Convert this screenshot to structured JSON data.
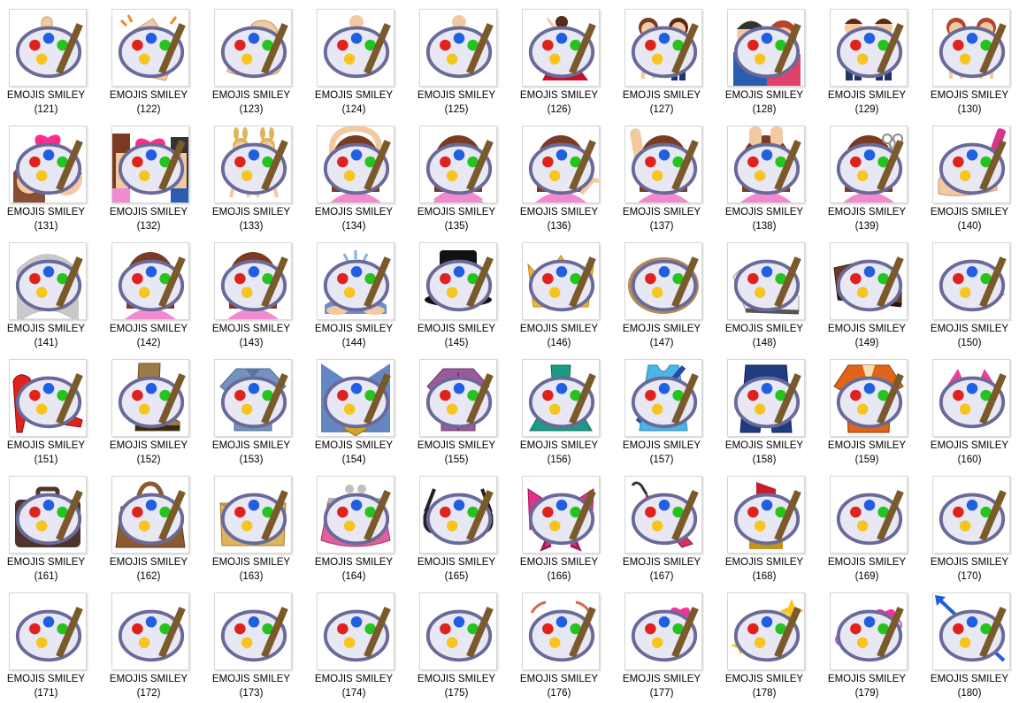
{
  "folder": {
    "label_prefix": "EMOJIS SMILEY",
    "items": [
      {
        "name": "EMOJIS SMILEY",
        "number": "(121)",
        "icon": "pointing-up-icon",
        "color": "#f3c9a0"
      },
      {
        "name": "EMOJIS SMILEY",
        "number": "(122)",
        "icon": "clapping-hands-icon",
        "color": "#f3c9a0"
      },
      {
        "name": "EMOJIS SMILEY",
        "number": "(123)",
        "icon": "flexed-biceps-icon",
        "color": "#f3c9a0"
      },
      {
        "name": "EMOJIS SMILEY",
        "number": "(124)",
        "icon": "person-walking-icon",
        "color": "#e02d2d"
      },
      {
        "name": "EMOJIS SMILEY",
        "number": "(125)",
        "icon": "person-running-icon",
        "color": "#e02d2d"
      },
      {
        "name": "EMOJIS SMILEY",
        "number": "(126)",
        "icon": "woman-dancing-icon",
        "color": "#c8102e"
      },
      {
        "name": "EMOJIS SMILEY",
        "number": "(127)",
        "icon": "couple-holding-hands-icon",
        "color": "#e84a7a"
      },
      {
        "name": "EMOJIS SMILEY",
        "number": "(128)",
        "icon": "family-icon",
        "color": "#2a5db0"
      },
      {
        "name": "EMOJIS SMILEY",
        "number": "(129)",
        "icon": "two-men-holding-hands-icon",
        "color": "#f39a1e"
      },
      {
        "name": "EMOJIS SMILEY",
        "number": "(130)",
        "icon": "two-women-holding-hands-icon",
        "color": "#ea6aa0"
      },
      {
        "name": "EMOJIS SMILEY",
        "number": "(131)",
        "icon": "kiss-icon",
        "color": "#ff2d8a"
      },
      {
        "name": "EMOJIS SMILEY",
        "number": "(132)",
        "icon": "couple-with-heart-icon",
        "color": "#ff2d8a"
      },
      {
        "name": "EMOJIS SMILEY",
        "number": "(133)",
        "icon": "women-with-bunny-ears-icon",
        "color": "#222222"
      },
      {
        "name": "EMOJIS SMILEY",
        "number": "(134)",
        "icon": "person-gesturing-ok-icon",
        "color": "#f08bd0"
      },
      {
        "name": "EMOJIS SMILEY",
        "number": "(135)",
        "icon": "person-gesturing-no-icon",
        "color": "#f08bd0"
      },
      {
        "name": "EMOJIS SMILEY",
        "number": "(136)",
        "icon": "person-tipping-hand-icon",
        "color": "#f08bd0"
      },
      {
        "name": "EMOJIS SMILEY",
        "number": "(137)",
        "icon": "person-raising-hand-icon",
        "color": "#f08bd0"
      },
      {
        "name": "EMOJIS SMILEY",
        "number": "(138)",
        "icon": "face-massage-icon",
        "color": "#f08bd0"
      },
      {
        "name": "EMOJIS SMILEY",
        "number": "(139)",
        "icon": "haircut-icon",
        "color": "#f08bd0"
      },
      {
        "name": "EMOJIS SMILEY",
        "number": "(140)",
        "icon": "nail-polish-icon",
        "color": "#d6348f"
      },
      {
        "name": "EMOJIS SMILEY",
        "number": "(141)",
        "icon": "bride-with-veil-icon",
        "color": "#c9c9c9"
      },
      {
        "name": "EMOJIS SMILEY",
        "number": "(142)",
        "icon": "person-pouting-icon",
        "color": "#f08bd0"
      },
      {
        "name": "EMOJIS SMILEY",
        "number": "(143)",
        "icon": "person-frowning-icon",
        "color": "#f08bd0"
      },
      {
        "name": "EMOJIS SMILEY",
        "number": "(144)",
        "icon": "person-bowing-icon",
        "color": "#7db3e8"
      },
      {
        "name": "EMOJIS SMILEY",
        "number": "(145)",
        "icon": "top-hat-icon",
        "color": "#111111"
      },
      {
        "name": "EMOJIS SMILEY",
        "number": "(146)",
        "icon": "crown-icon",
        "color": "#f1b82d"
      },
      {
        "name": "EMOJIS SMILEY",
        "number": "(147)",
        "icon": "womans-hat-icon",
        "color": "#b58a55"
      },
      {
        "name": "EMOJIS SMILEY",
        "number": "(148)",
        "icon": "running-shoe-icon",
        "color": "#eeeeee"
      },
      {
        "name": "EMOJIS SMILEY",
        "number": "(149)",
        "icon": "mans-shoe-icon",
        "color": "#6b3a1f"
      },
      {
        "name": "EMOJIS SMILEY",
        "number": "(150)",
        "icon": "womans-sandal-icon",
        "color": "#d9c39a"
      },
      {
        "name": "EMOJIS SMILEY",
        "number": "(151)",
        "icon": "high-heeled-shoe-icon",
        "color": "#e0221d"
      },
      {
        "name": "EMOJIS SMILEY",
        "number": "(152)",
        "icon": "womans-boot-icon",
        "color": "#9b7a45"
      },
      {
        "name": "EMOJIS SMILEY",
        "number": "(153)",
        "icon": "t-shirt-icon",
        "color": "#7393bd"
      },
      {
        "name": "EMOJIS SMILEY",
        "number": "(154)",
        "icon": "necktie-icon",
        "color": "#6487c4"
      },
      {
        "name": "EMOJIS SMILEY",
        "number": "(155)",
        "icon": "blouse-icon",
        "color": "#9c5a9a"
      },
      {
        "name": "EMOJIS SMILEY",
        "number": "(156)",
        "icon": "dress-icon",
        "color": "#199b84"
      },
      {
        "name": "EMOJIS SMILEY",
        "number": "(157)",
        "icon": "tank-top-icon",
        "color": "#4bb6e6"
      },
      {
        "name": "EMOJIS SMILEY",
        "number": "(158)",
        "icon": "jeans-icon",
        "color": "#1e3d80"
      },
      {
        "name": "EMOJIS SMILEY",
        "number": "(159)",
        "icon": "kimono-icon",
        "color": "#e0651a"
      },
      {
        "name": "EMOJIS SMILEY",
        "number": "(160)",
        "icon": "bikini-icon",
        "color": "#ee3d9a"
      },
      {
        "name": "EMOJIS SMILEY",
        "number": "(161)",
        "icon": "briefcase-icon",
        "color": "#4f342b"
      },
      {
        "name": "EMOJIS SMILEY",
        "number": "(162)",
        "icon": "handbag-icon",
        "color": "#8b5a30"
      },
      {
        "name": "EMOJIS SMILEY",
        "number": "(163)",
        "icon": "clutch-bag-icon",
        "color": "#e0b35d"
      },
      {
        "name": "EMOJIS SMILEY",
        "number": "(164)",
        "icon": "purse-icon",
        "color": "#e25f9c"
      },
      {
        "name": "EMOJIS SMILEY",
        "number": "(165)",
        "icon": "glasses-icon",
        "color": "#222222"
      },
      {
        "name": "EMOJIS SMILEY",
        "number": "(166)",
        "icon": "ribbon-icon",
        "color": "#e0308a"
      },
      {
        "name": "EMOJIS SMILEY",
        "number": "(167)",
        "icon": "closed-umbrella-icon",
        "color": "#d82e63"
      },
      {
        "name": "EMOJIS SMILEY",
        "number": "(168)",
        "icon": "lipstick-icon",
        "color": "#c81b2e"
      },
      {
        "name": "EMOJIS SMILEY",
        "number": "(169)",
        "icon": "yellow-heart-icon",
        "color": "#f7c51e"
      },
      {
        "name": "EMOJIS SMILEY",
        "number": "(170)",
        "icon": "blue-heart-icon",
        "color": "#1f5fe0"
      },
      {
        "name": "EMOJIS SMILEY",
        "number": "(171)",
        "icon": "purple-heart-icon",
        "color": "#9b2ee0"
      },
      {
        "name": "EMOJIS SMILEY",
        "number": "(172)",
        "icon": "green-heart-icon",
        "color": "#24c41f"
      },
      {
        "name": "EMOJIS SMILEY",
        "number": "(173)",
        "icon": "red-heart-icon",
        "color": "#dd1a1a"
      },
      {
        "name": "EMOJIS SMILEY",
        "number": "(174)",
        "icon": "broken-heart-icon",
        "color": "#c81a1a"
      },
      {
        "name": "EMOJIS SMILEY",
        "number": "(175)",
        "icon": "growing-heart-icon",
        "color": "#f06cb4"
      },
      {
        "name": "EMOJIS SMILEY",
        "number": "(176)",
        "icon": "beating-heart-icon",
        "color": "#f0339a"
      },
      {
        "name": "EMOJIS SMILEY",
        "number": "(177)",
        "icon": "two-hearts-icon",
        "color": "#f0339a"
      },
      {
        "name": "EMOJIS SMILEY",
        "number": "(178)",
        "icon": "sparkling-heart-icon",
        "color": "#f0339a"
      },
      {
        "name": "EMOJIS SMILEY",
        "number": "(179)",
        "icon": "revolving-hearts-icon",
        "color": "#f0339a"
      },
      {
        "name": "EMOJIS SMILEY",
        "number": "(180)",
        "icon": "heart-with-arrow-icon",
        "color": "#f0339a"
      }
    ]
  }
}
